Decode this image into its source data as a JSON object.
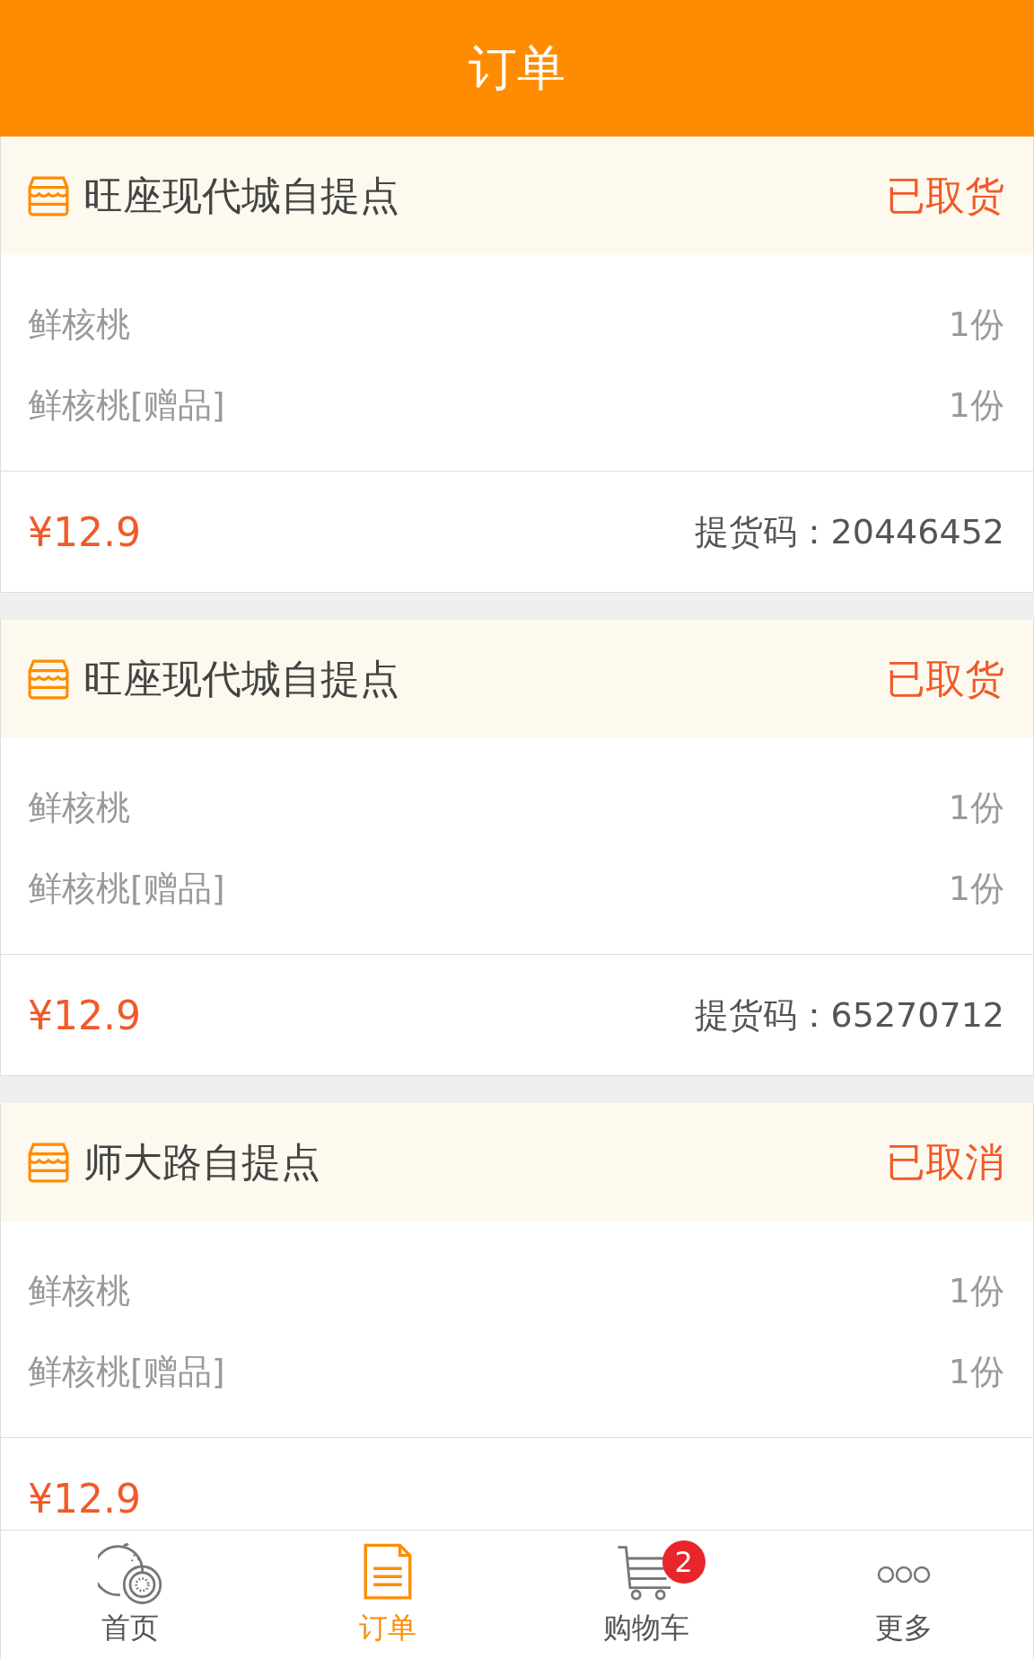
{
  "header": {
    "title": "订单"
  },
  "orders": [
    {
      "store": "旺座现代城自提点",
      "status": "已取货",
      "items": [
        {
          "name": "鲜核桃",
          "qty": "1份"
        },
        {
          "name": "鲜核桃[赠品]",
          "qty": "1份"
        }
      ],
      "price": "¥12.9",
      "code_label": "提货码：",
      "code": "20446452"
    },
    {
      "store": "旺座现代城自提点",
      "status": "已取货",
      "items": [
        {
          "name": "鲜核桃",
          "qty": "1份"
        },
        {
          "name": "鲜核桃[赠品]",
          "qty": "1份"
        }
      ],
      "price": "¥12.9",
      "code_label": "提货码：",
      "code": "65270712"
    },
    {
      "store": "师大路自提点",
      "status": "已取消",
      "items": [
        {
          "name": "鲜核桃",
          "qty": "1份"
        },
        {
          "name": "鲜核桃[赠品]",
          "qty": "1份"
        }
      ],
      "price": "¥12.9"
    }
  ],
  "tabbar": [
    {
      "label": "首页",
      "kind": "home",
      "selected": false
    },
    {
      "label": "订单",
      "kind": "orders",
      "selected": true
    },
    {
      "label": "购物车",
      "kind": "cart",
      "selected": false,
      "badge": "2"
    },
    {
      "label": "更多",
      "kind": "more",
      "selected": false
    }
  ]
}
